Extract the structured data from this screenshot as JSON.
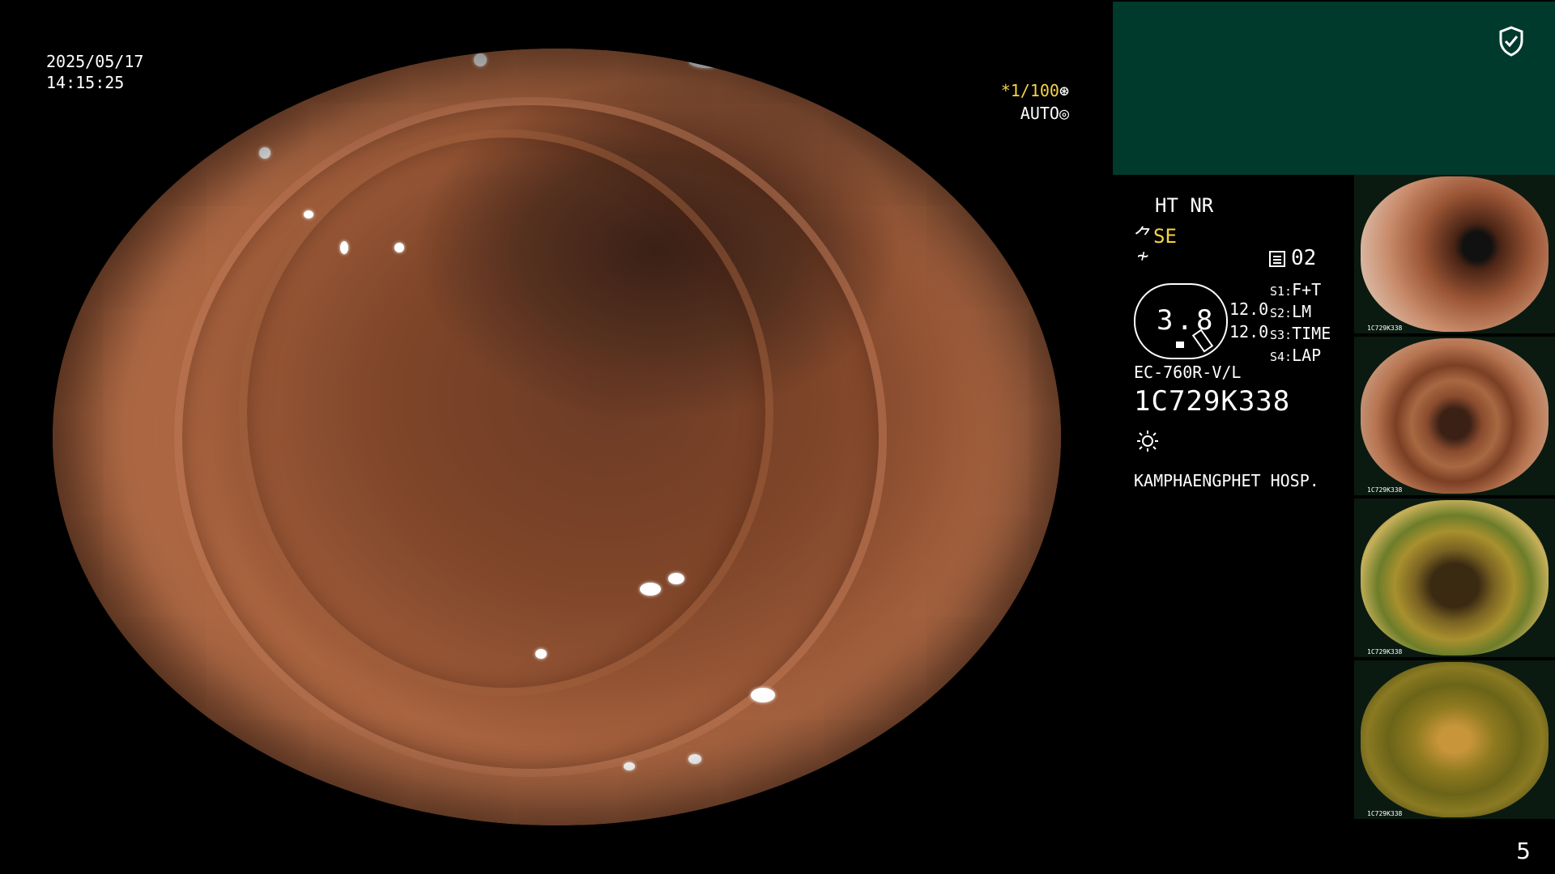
{
  "osd": {
    "date": "2025/05/17",
    "time": "14:15:25",
    "shutter_prefix": "*1/100",
    "exposure_mode": "AUTO"
  },
  "status": {
    "ht_nr": "HT NR",
    "se_label": "SE",
    "gauge_value": "3.8",
    "gauge_num_1": "12.0",
    "gauge_num_2": "12.0",
    "record_count": "02",
    "scope_model": "EC-760R-V/L",
    "scope_serial": "1C729K338",
    "hospital": "KAMPHAENGPHET HOSP."
  },
  "switches": [
    {
      "label": "S1:",
      "value": "F+T"
    },
    {
      "label": "S2:",
      "value": "LM"
    },
    {
      "label": "S3:",
      "value": "TIME"
    },
    {
      "label": "S4:",
      "value": "LAP"
    }
  ],
  "thumbnails": [
    {
      "caption": "1C729K338"
    },
    {
      "caption": "1C729K338"
    },
    {
      "caption": "1C729K338"
    },
    {
      "caption": "1C729K338"
    }
  ],
  "page_number": "5",
  "colors": {
    "accent_yellow": "#f5d442",
    "panel_green": "#003a2c",
    "background": "#000000"
  },
  "icons": [
    "shield-check-icon",
    "shutter-icon",
    "auto-iris-icon",
    "light-icon",
    "record-icon"
  ]
}
